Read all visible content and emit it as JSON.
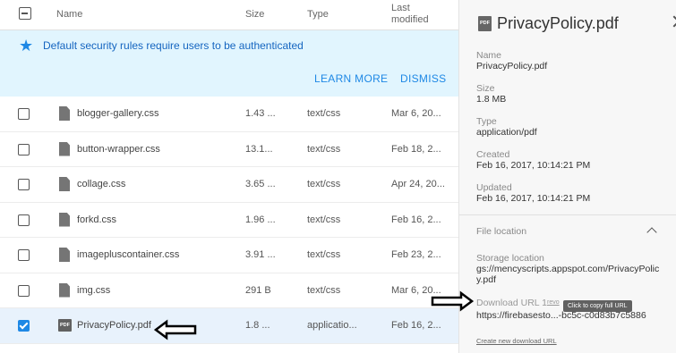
{
  "header": {
    "name": "Name",
    "size": "Size",
    "type": "Type",
    "modified": "Last modified"
  },
  "banner": {
    "icon": "star-icon",
    "text": "Default security rules require users to be authenticated",
    "learn_more": "LEARN MORE",
    "dismiss": "DISMISS",
    "accent": "#1e88e5"
  },
  "files": [
    {
      "name": "blogger-gallery.css",
      "size": "1.43 ...",
      "type": "text/css",
      "modified": "Mar 6, 20...",
      "icon": "file-icon",
      "checked": false
    },
    {
      "name": "button-wrapper.css",
      "size": "13.1...",
      "type": "text/css",
      "modified": "Feb 18, 2...",
      "icon": "file-icon",
      "checked": false
    },
    {
      "name": "collage.css",
      "size": "3.65 ...",
      "type": "text/css",
      "modified": "Apr 24, 20...",
      "icon": "file-icon",
      "checked": false
    },
    {
      "name": "forkd.css",
      "size": "1.96 ...",
      "type": "text/css",
      "modified": "Feb 16, 2...",
      "icon": "file-icon",
      "checked": false
    },
    {
      "name": "imagepluscontainer.css",
      "size": "3.91 ...",
      "type": "text/css",
      "modified": "Feb 23, 2...",
      "icon": "file-icon",
      "checked": false
    },
    {
      "name": "img.css",
      "size": "291 B",
      "type": "text/css",
      "modified": "Mar 6, 20...",
      "icon": "file-icon",
      "checked": false
    },
    {
      "name": "PrivacyPolicy.pdf",
      "size": "1.8 ...",
      "type": "applicatio...",
      "modified": "Feb 16, 2...",
      "icon": "pdf-icon",
      "checked": true
    }
  ],
  "detail": {
    "title": "PrivacyPolicy.pdf",
    "pdf_icon_text": "PDF",
    "name_label": "Name",
    "name_value": "PrivacyPolicy.pdf",
    "size_label": "Size",
    "size_value": "1.8 MB",
    "type_label": "Type",
    "type_value": "application/pdf",
    "created_label": "Created",
    "created_value": "Feb 16, 2017, 10:14:21 PM",
    "updated_label": "Updated",
    "updated_value": "Feb 16, 2017, 10:14:21 PM",
    "file_location": "File location",
    "storage_label": "Storage location",
    "storage_value": "gs://mencyscripts.appspot.com/PrivacyPolicy.pdf",
    "download_label": "Download URL 1",
    "revoke": "revo",
    "download_value": "https://firebasesto...-bc5c-c0d83b7c5886",
    "tooltip": "Click to copy full URL",
    "create_link": "Create new download URL"
  }
}
